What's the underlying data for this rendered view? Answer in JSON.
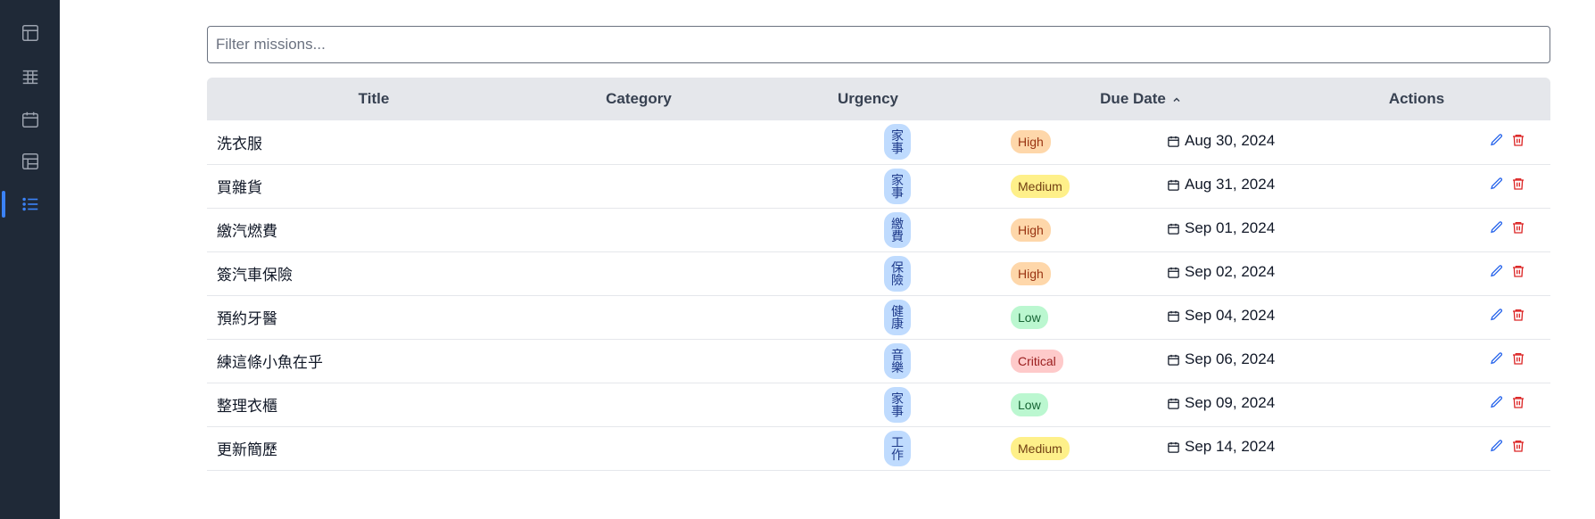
{
  "sidebar": {
    "items": [
      {
        "icon": "table-layout-icon",
        "active": false
      },
      {
        "icon": "table-rows-icon",
        "active": false
      },
      {
        "icon": "calendar-icon",
        "active": false
      },
      {
        "icon": "panel-layout-icon",
        "active": false
      },
      {
        "icon": "list-icon",
        "active": true
      }
    ],
    "colors": {
      "background": "#1f2937",
      "icon": "#9ca3af",
      "active": "#3b82f6"
    }
  },
  "filter": {
    "placeholder": "Filter missions...",
    "value": ""
  },
  "table": {
    "headers": {
      "title": "Title",
      "category": "Category",
      "urgency": "Urgency",
      "due_date": "Due Date",
      "actions": "Actions"
    },
    "sort": {
      "column": "due_date",
      "direction": "ascending",
      "icon": "chevron-up-icon"
    },
    "rows": [
      {
        "title": "洗衣服",
        "category": "家事",
        "urgency": "High",
        "due_date": "Aug 30, 2024"
      },
      {
        "title": "買雜貨",
        "category": "家事",
        "urgency": "Medium",
        "due_date": "Aug 31, 2024"
      },
      {
        "title": "繳汽燃費",
        "category": "繳費",
        "urgency": "High",
        "due_date": "Sep 01, 2024"
      },
      {
        "title": "簽汽車保險",
        "category": "保險",
        "urgency": "High",
        "due_date": "Sep 02, 2024"
      },
      {
        "title": "預約牙醫",
        "category": "健康",
        "urgency": "Low",
        "due_date": "Sep 04, 2024"
      },
      {
        "title": "練這條小魚在乎",
        "category": "音樂",
        "urgency": "Critical",
        "due_date": "Sep 06, 2024"
      },
      {
        "title": "整理衣櫃",
        "category": "家事",
        "urgency": "Low",
        "due_date": "Sep 09, 2024"
      },
      {
        "title": "更新簡歷",
        "category": "工作",
        "urgency": "Medium",
        "due_date": "Sep 14, 2024"
      }
    ],
    "row_actions": [
      {
        "icon": "pencil-icon",
        "color": "#2563eb"
      },
      {
        "icon": "trash-icon",
        "color": "#dc2626"
      }
    ]
  }
}
